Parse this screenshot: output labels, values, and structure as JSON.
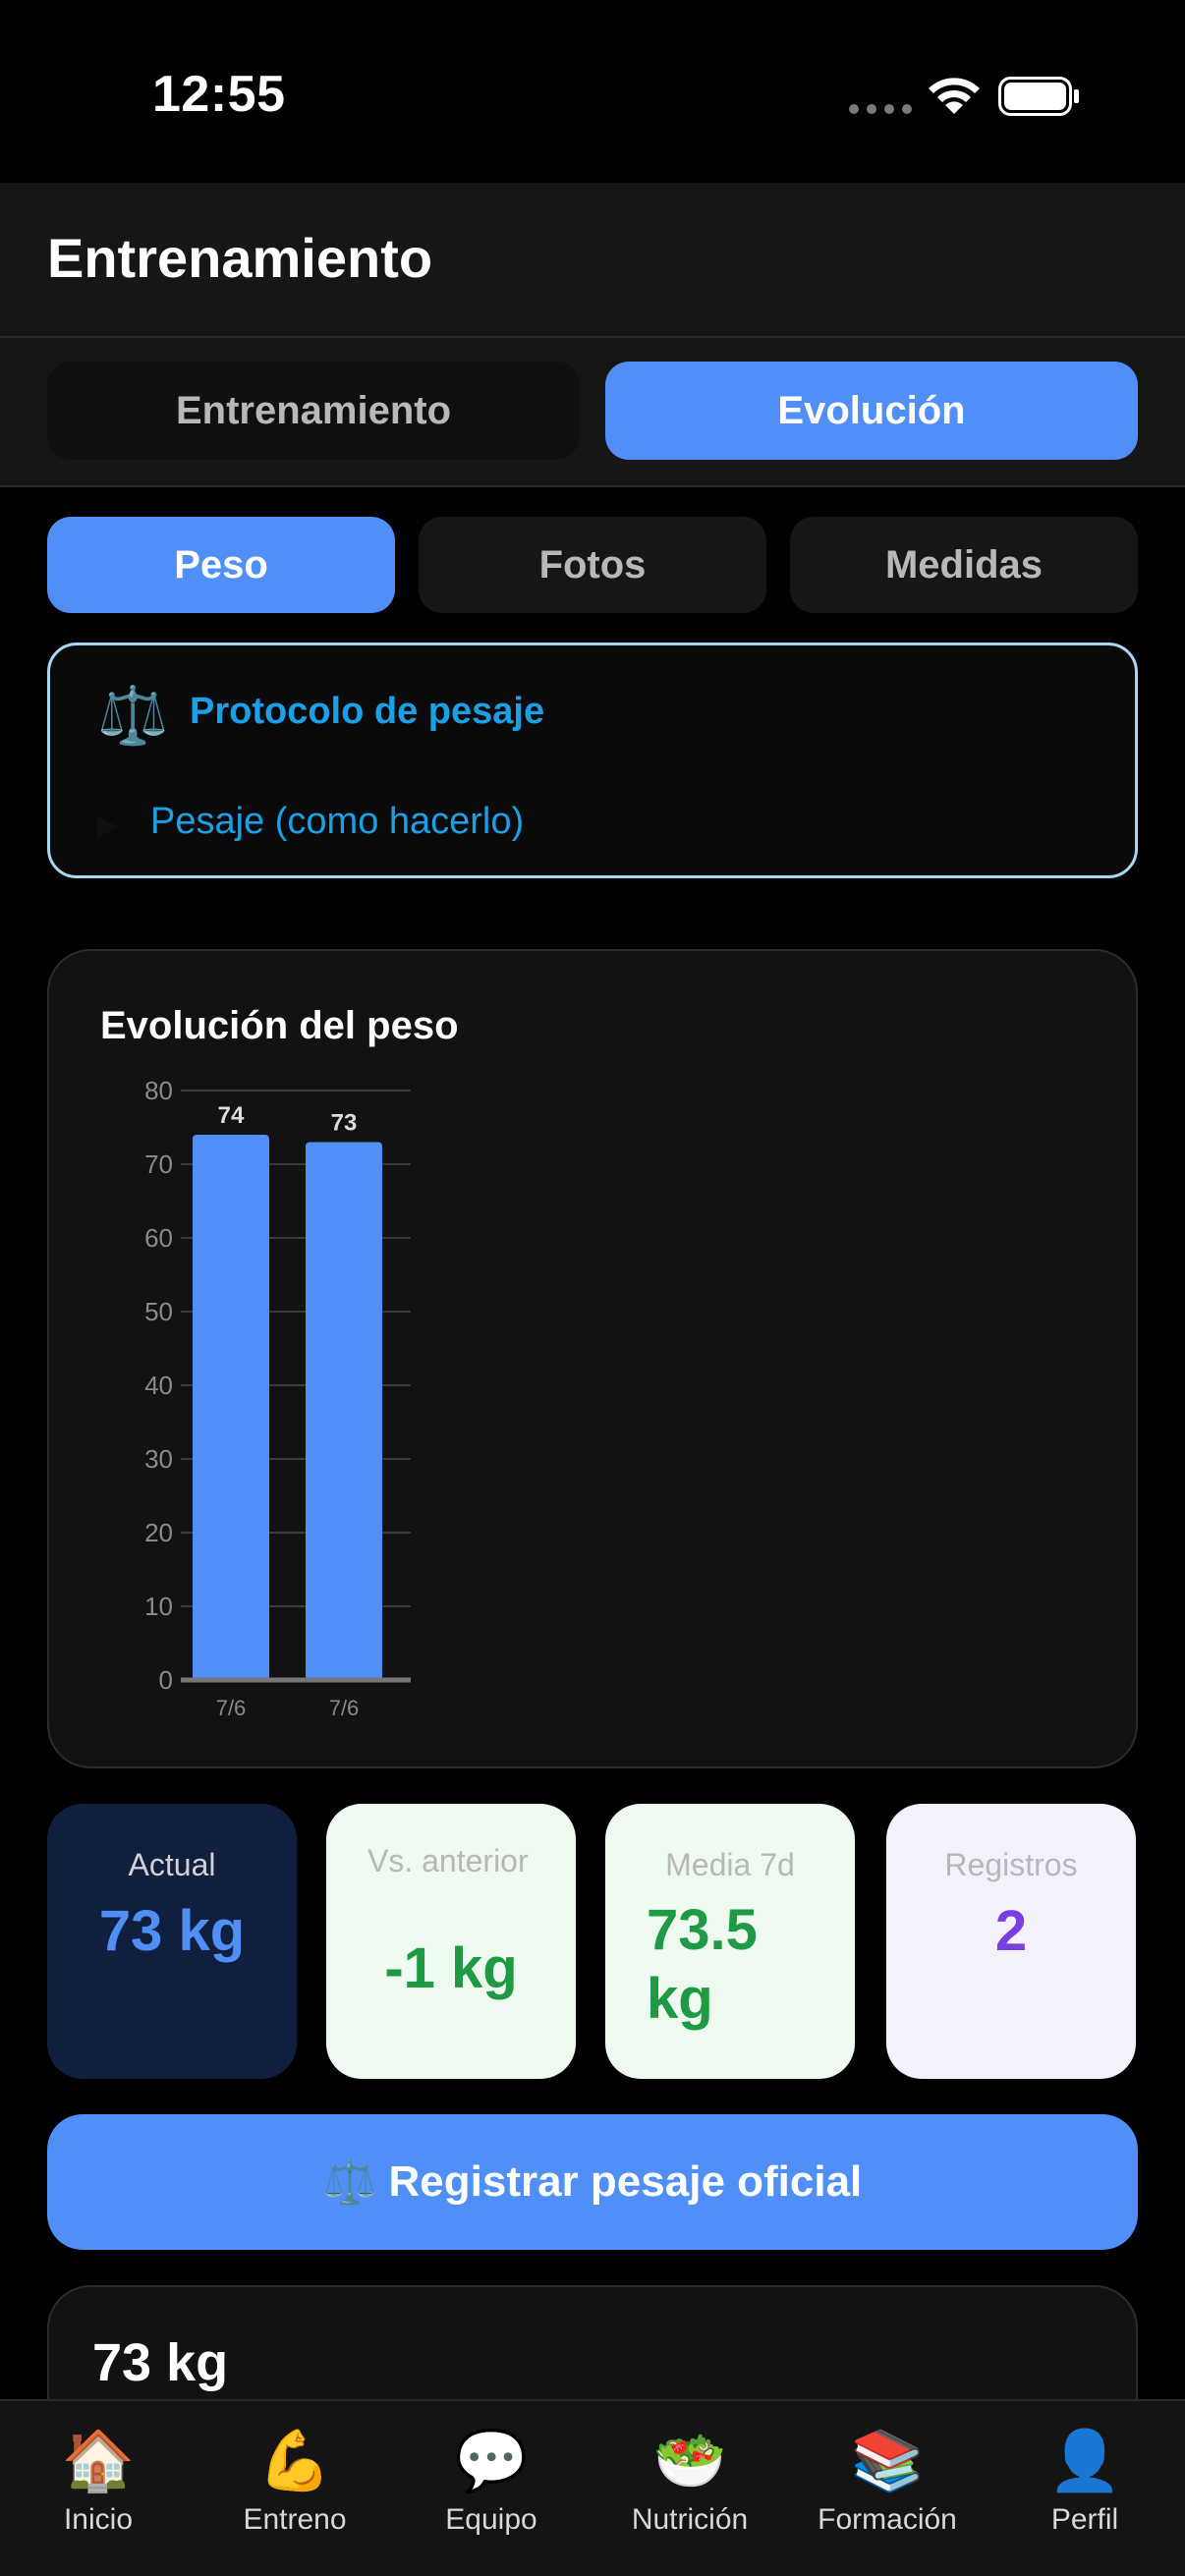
{
  "status_bar": {
    "time": "12:55"
  },
  "header": {
    "title": "Entrenamiento"
  },
  "segments": {
    "left": "Entrenamiento",
    "right": "Evolución",
    "active": "Evolución"
  },
  "subtabs": {
    "peso": "Peso",
    "fotos": "Fotos",
    "medidas": "Medidas",
    "active": "Peso"
  },
  "protocol": {
    "icon": "scale-icon",
    "title": "Protocolo de pesaje",
    "link": "Pesaje (como hacerlo)"
  },
  "chart_data": {
    "type": "bar",
    "title": "Evolución del peso",
    "categories": [
      "7/6",
      "7/6"
    ],
    "values": [
      74,
      73
    ],
    "data_labels": [
      "74",
      "73"
    ],
    "ylim": [
      0,
      80
    ],
    "yticks": [
      "80",
      "70",
      "60",
      "50",
      "40",
      "30",
      "20",
      "10",
      "0"
    ],
    "grid": true,
    "color": "#4f8ff7"
  },
  "stats": {
    "actual": {
      "label": "Actual",
      "value": "73 kg"
    },
    "vs_anterior": {
      "label": "Vs. anterior",
      "value": "-1 kg"
    },
    "media": {
      "label": "Media 7d",
      "value": "73.5 kg"
    },
    "registros": {
      "label": "Registros",
      "value": "2"
    }
  },
  "register_button": {
    "icon": "scale-icon",
    "label": "Registrar pesaje oficial"
  },
  "entry": {
    "weight": "73 kg"
  },
  "nav": [
    {
      "label": "Inicio",
      "icon": "home-icon"
    },
    {
      "label": "Entreno",
      "icon": "flexed-biceps-icon"
    },
    {
      "label": "Equipo",
      "icon": "chat-bubble-icon"
    },
    {
      "label": "Nutrición",
      "icon": "salad-icon"
    },
    {
      "label": "Formación",
      "icon": "books-icon"
    },
    {
      "label": "Perfil",
      "icon": "user-silhouette-icon"
    }
  ],
  "colors": {
    "accent": "#4f8ff7",
    "link": "#1aa0e6",
    "positive": "#1e9a44",
    "purple": "#7b3ee0"
  }
}
